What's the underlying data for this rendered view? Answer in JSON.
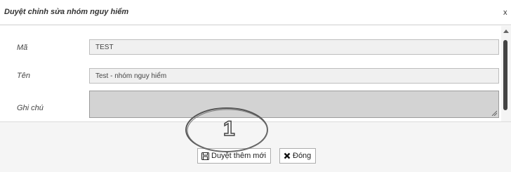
{
  "dialog": {
    "title": "Duyệt chỉnh sửa nhóm nguy hiểm",
    "close_label": "x"
  },
  "form": {
    "ma_label": "Mã",
    "ma_value": "TEST",
    "ten_label": "Tên",
    "ten_value": "Test - nhóm nguy hiểm",
    "ghichu_label": "Ghi chú",
    "ghichu_value": ""
  },
  "footer": {
    "approve_new_label": "Duyệt thêm mới",
    "close_button_label": "Đóng"
  },
  "annotation": {
    "number": "1"
  },
  "icons": {
    "approve": "save-icon",
    "close": "times-icon"
  }
}
